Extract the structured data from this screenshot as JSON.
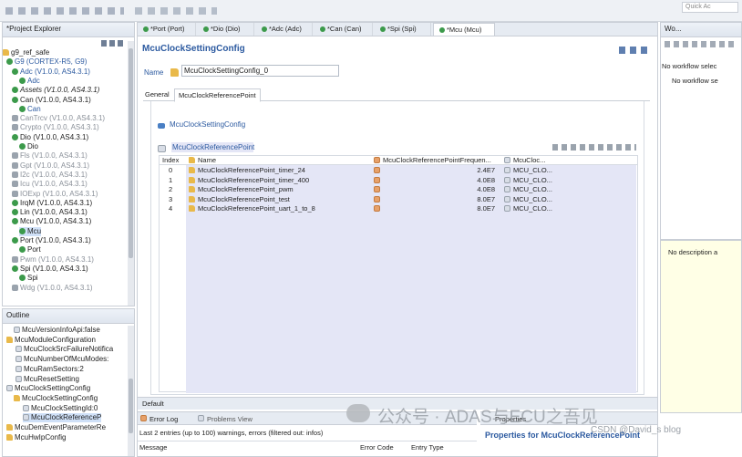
{
  "top_toolbar": {
    "right_label": "Quick Ac"
  },
  "project_explorer": {
    "title": "*Project Explorer",
    "items": [
      {
        "label": "g9_ref_safe",
        "dim": false
      },
      {
        "label": "G9 (CORTEX-R5, G9)",
        "dim": false,
        "blue": true
      },
      {
        "label": "Adc (V1.0.0, AS4.3.1)",
        "dim": false,
        "blue": true
      },
      {
        "label": "Adc",
        "dim": false,
        "blue": true
      },
      {
        "label": "Assets (V1.0.0, AS4.3.1)",
        "dim": false,
        "italic": true
      },
      {
        "label": "Can (V1.0.0, AS4.3.1)",
        "dim": false
      },
      {
        "label": "Can",
        "dim": false,
        "blue": true
      },
      {
        "label": "CanTrcv (V1.0.0, AS4.3.1)",
        "dim": true
      },
      {
        "label": "Crypto (V1.0.0, AS4.3.1)",
        "dim": true
      },
      {
        "label": "Dio (V1.0.0, AS4.3.1)",
        "dim": false
      },
      {
        "label": "Dio",
        "dim": false
      },
      {
        "label": "Fls (V1.0.0, AS4.3.1)",
        "dim": true
      },
      {
        "label": "Gpt (V1.0.0, AS4.3.1)",
        "dim": true
      },
      {
        "label": "I2c (V1.0.0, AS4.3.1)",
        "dim": true
      },
      {
        "label": "Icu (V1.0.0, AS4.3.1)",
        "dim": true
      },
      {
        "label": "IOExp (V1.0.0, AS4.3.1)",
        "dim": true
      },
      {
        "label": "IrqM (V1.0.0, AS4.3.1)",
        "dim": false
      },
      {
        "label": "Lin (V1.0.0, AS4.3.1)",
        "dim": false
      },
      {
        "label": "Mcu (V1.0.0, AS4.3.1)",
        "dim": false
      },
      {
        "label": "Mcu",
        "dim": false,
        "selected": true
      },
      {
        "label": "Port (V1.0.0, AS4.3.1)",
        "dim": false
      },
      {
        "label": "Port",
        "dim": false
      },
      {
        "label": "Pwm (V1.0.0, AS4.3.1)",
        "dim": true
      },
      {
        "label": "Spi (V1.0.0, AS4.3.1)",
        "dim": false
      },
      {
        "label": "Spi",
        "dim": false
      },
      {
        "label": "Wdg (V1.0.0, AS4.3.1)",
        "dim": true
      }
    ]
  },
  "outline": {
    "title": "Outline",
    "items": [
      {
        "label": "McuVersionInfoApi:false"
      },
      {
        "label": "McuModuleConfiguration"
      },
      {
        "label": "McuClockSrcFailureNotifica"
      },
      {
        "label": "McuNumberOfMcuModes:"
      },
      {
        "label": "McuRamSectors:2"
      },
      {
        "label": "McuResetSetting"
      },
      {
        "label": "McuClockSettingConfig"
      },
      {
        "label": "McuClockSettingConfig"
      },
      {
        "label": "McuClockSettingId:0"
      },
      {
        "label": "McuClockReferenceP"
      },
      {
        "label": "McuDemEventParameterRe"
      },
      {
        "label": "McuHwIpConfig"
      }
    ]
  },
  "editor_tabs": [
    {
      "label": "*Port (Port)",
      "active": false
    },
    {
      "label": "*Dio (Dio)",
      "active": false
    },
    {
      "label": "*Adc (Adc)",
      "active": false
    },
    {
      "label": "*Can (Can)",
      "active": false
    },
    {
      "label": "*Spi (Spi)",
      "active": false
    },
    {
      "label": "*Mcu (Mcu)",
      "active": true
    }
  ],
  "editor": {
    "title": "McuClockSettingConfig",
    "name_label": "Name",
    "name_value": "McuClockSettingConfig_0",
    "sub_tabs": [
      "General",
      "McuClockReferencePoint"
    ],
    "link_label": "McuClockSettingConfig",
    "section_label": "McuClockReferencePoint",
    "columns": [
      "Index",
      "Name",
      "McuClockReferencePointFrequen...",
      "McuCloc..."
    ],
    "rows": [
      {
        "index": "0",
        "name": "McuClockReferencePoint_timer_24",
        "freq": "2.4E7",
        "ref": "MCU_CLO..."
      },
      {
        "index": "1",
        "name": "McuClockReferencePoint_timer_400",
        "freq": "4.0E8",
        "ref": "MCU_CLO..."
      },
      {
        "index": "2",
        "name": "McuClockReferencePoint_pwm",
        "freq": "4.0E8",
        "ref": "MCU_CLO..."
      },
      {
        "index": "3",
        "name": "McuClockReferencePoint_test",
        "freq": "8.0E7",
        "ref": "MCU_CLO..."
      },
      {
        "index": "4",
        "name": "McuClockReferencePoint_uart_1_to_8",
        "freq": "8.0E7",
        "ref": "MCU_CLO..."
      }
    ],
    "default_tab": "Default"
  },
  "right_panel": {
    "title": "Wo...",
    "no_workflow_1": "No workflow selec",
    "no_workflow_2": "No workflow se",
    "no_description": "No description a"
  },
  "bottom": {
    "error_log_tab": "Error Log",
    "problems_tab": "Problems View",
    "summary": "Last 2 entries (up to 100) warnings, errors (filtered out: infos)",
    "col_message": "Message",
    "col_error_code": "Error Code",
    "col_entry_type": "Entry Type",
    "properties_tab": "Properties",
    "properties_title": "Properties for McuClockReferencePoint"
  },
  "watermark": {
    "text": "公众号 · ADAS与ECU之吾见",
    "csdn": "CSDN @David_s blog"
  }
}
